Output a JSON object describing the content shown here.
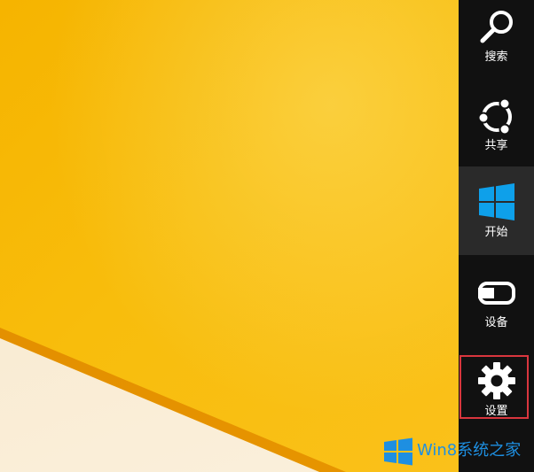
{
  "colors": {
    "wallpaper": "#f8bd0c",
    "charms_bar": "#111111",
    "active_charm": "#2a2a2a",
    "start_logo": "#0ea0ea",
    "highlight": "#d9363e",
    "watermark": "#1e8fe1"
  },
  "charms": [
    {
      "label": "搜索",
      "icon": "search-icon"
    },
    {
      "label": "共享",
      "icon": "share-icon"
    },
    {
      "label": "开始",
      "icon": "windows-logo-icon",
      "active": true
    },
    {
      "label": "设备",
      "icon": "devices-icon"
    },
    {
      "label": "设置",
      "icon": "gear-icon",
      "highlighted": true
    }
  ],
  "watermark": {
    "text": "Win8系统之家",
    "icon": "windows-logo-icon"
  }
}
